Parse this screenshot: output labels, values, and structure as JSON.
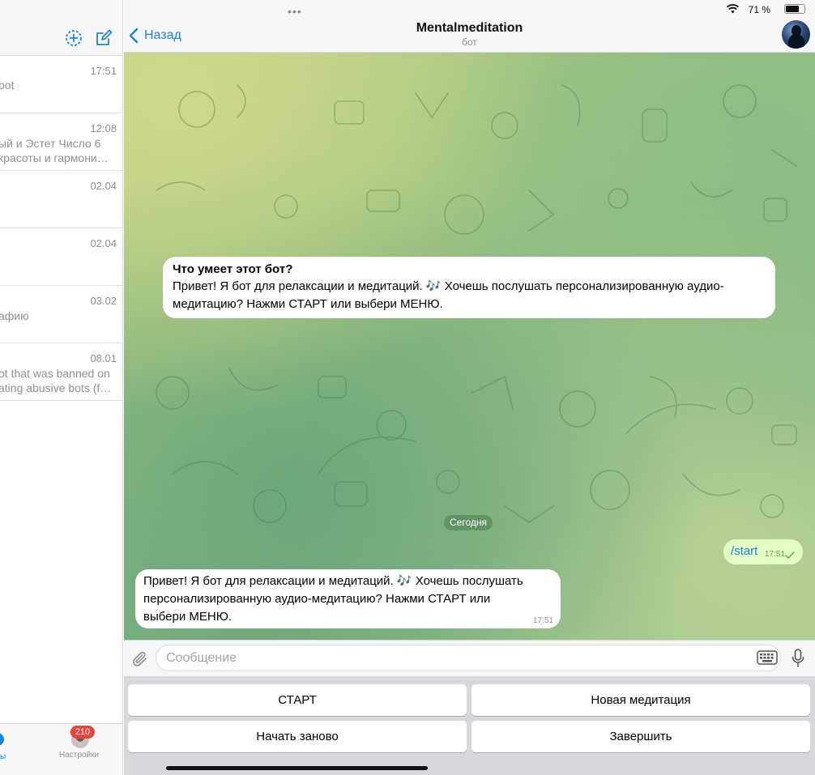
{
  "status_bar": {
    "battery": "71 %"
  },
  "chat_list": {
    "rows": [
      {
        "time": "17:51",
        "line1": "bot",
        "line2": ""
      },
      {
        "time": "12:08",
        "line1": "ый и Эстет Число 6",
        "line2": "красоты и гармони…"
      },
      {
        "time": "02.04",
        "line1": "",
        "line2": ""
      },
      {
        "time": "02.04",
        "line1": "",
        "line2": ""
      },
      {
        "time": "03.02",
        "line1": "афию",
        "line2": ""
      },
      {
        "time": "08.01",
        "line1": "ot that was banned on",
        "line2": "ating abusive bots (f…"
      }
    ],
    "settings_badge": "210",
    "settings_label": "Настройки",
    "chats_label": "ы"
  },
  "header": {
    "back_label": "Назад",
    "title": "Mentalmeditation",
    "subtitle": "бот"
  },
  "messages": {
    "info_title": "Что умеет этот бот?",
    "info_line1": "Привет! Я бот для релаксации и медитаций. 🎶 Хочешь послушать персонализированную аудио-",
    "info_line2": "медитацию? Нажми СТАРТ или выбери МЕНЮ.",
    "date_separator": "Сегодня",
    "outgoing_text": "/start",
    "outgoing_time": "17:51",
    "reply_line1": "Привет! Я бот для релаксации и медитаций. 🎶 Хочешь послушать",
    "reply_line2": "персонализированную аудио-медитацию? Нажми СТАРТ или",
    "reply_line3": "выбери МЕНЮ.",
    "reply_time": "17:51"
  },
  "input": {
    "placeholder": "Сообщение",
    "value": ""
  },
  "keyboard": {
    "buttons": [
      "СТАРТ",
      "Новая медитация",
      "Начать заново",
      "Завершить"
    ]
  },
  "colors": {
    "accent": "#1a83e8",
    "outgoing_bubble": "#e1fec6",
    "badge": "#e8443a"
  }
}
